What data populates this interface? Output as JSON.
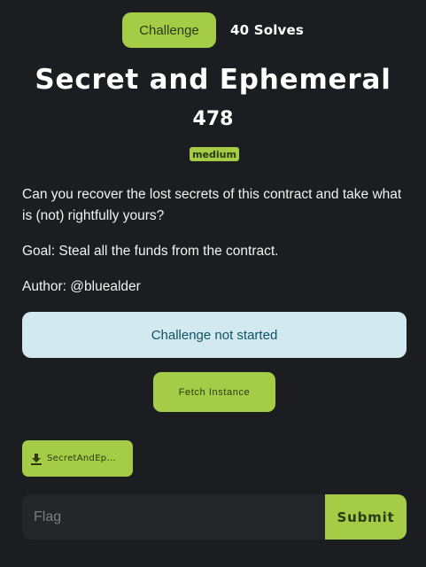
{
  "tabs": {
    "challenge_label": "Challenge",
    "solves_label": "40 Solves"
  },
  "challenge": {
    "title": "Secret and Ephemeral",
    "points": "478",
    "difficulty": "medium",
    "description": [
      "Can you recover the lost secrets of this contract and take what is (not) rightfully yours?",
      "Goal: Steal all the funds from the contract.",
      "Author: @bluealder"
    ]
  },
  "status": {
    "text": "Challenge not started"
  },
  "actions": {
    "fetch_label": "Fetch Instance",
    "file_label": "SecretAndEp...",
    "file_icon": "download-icon"
  },
  "flag": {
    "placeholder": "Flag",
    "value": "",
    "submit_label": "Submit"
  },
  "colors": {
    "background": "#1c1d20",
    "accent": "#a4cc46",
    "status_bg": "#d1e9ef",
    "status_text": "#0f5565"
  }
}
